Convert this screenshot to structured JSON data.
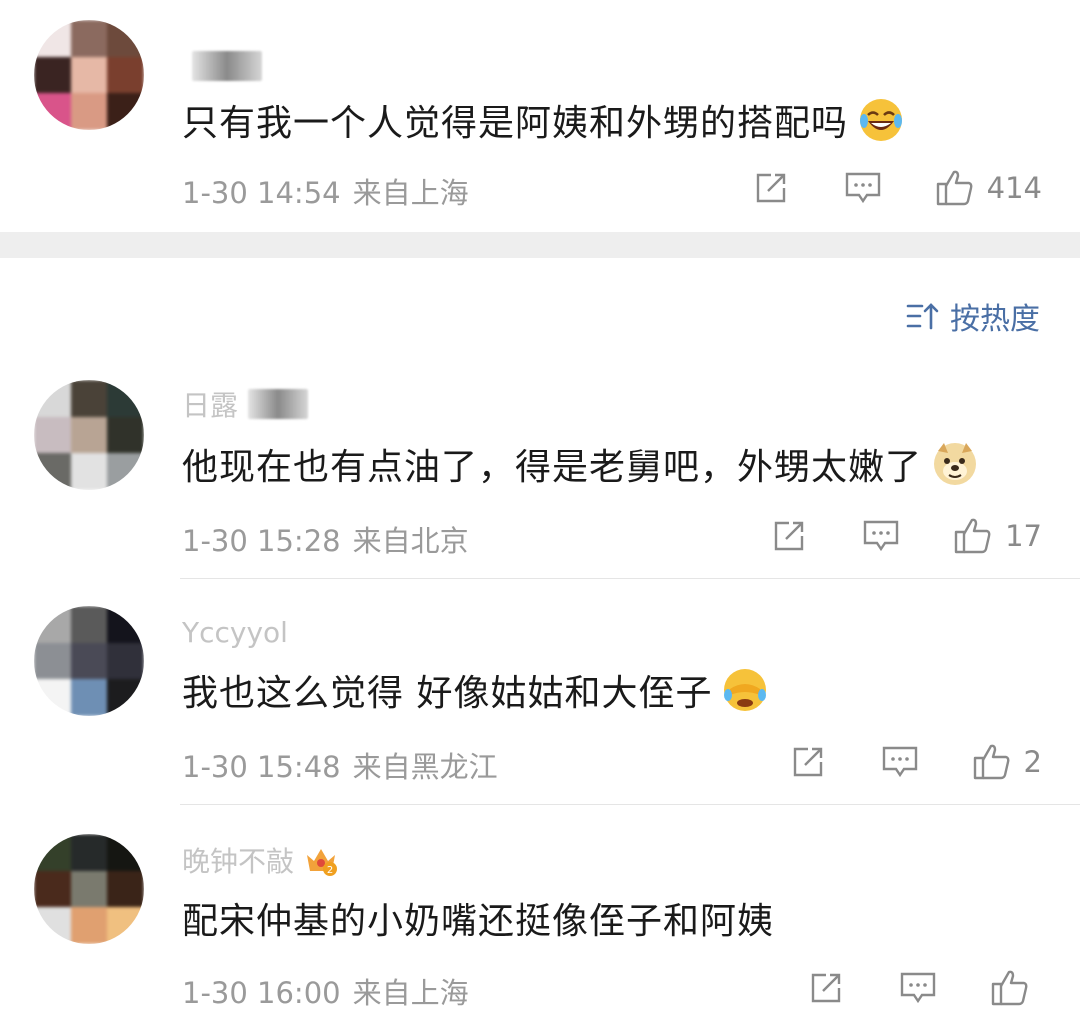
{
  "sort": {
    "label": "按热度",
    "icon": "sort-icon"
  },
  "comments": [
    {
      "username": "",
      "text": "只有我一个人觉得是阿姨和外甥的搭配吗",
      "emoji": "laugh-tears-emoji",
      "date": "1-30 14:54",
      "location": "来自上海",
      "likes": "414",
      "avatar_colors": [
        "#f0e6e6",
        "#8b6a5f",
        "#6d4a3c",
        "#3a2422",
        "#e6b8a6",
        "#7a3f2e",
        "#d9548a",
        "#d99a84",
        "#3b2018"
      ]
    },
    {
      "username": "日露",
      "text": "他现在也有点油了，得是老舅吧，外甥太嫩了",
      "emoji": "doge-emoji",
      "date": "1-30 15:28",
      "location": "来自北京",
      "likes": "17",
      "avatar_colors": [
        "#d8d8d8",
        "#4a4238",
        "#2c3a36",
        "#c8bcc0",
        "#b8a494",
        "#30322a",
        "#6a6a66",
        "#e2e2e2",
        "#9a9ea0"
      ]
    },
    {
      "username": "Yccyyol",
      "text": "我也这么觉得 好像姑姑和大侄子",
      "emoji": "cover-face-emoji",
      "date": "1-30 15:48",
      "location": "来自黑龙江",
      "likes": "2",
      "avatar_colors": [
        "#a8a8a8",
        "#5a5a5a",
        "#14141c",
        "#8c8f94",
        "#4a4a56",
        "#30303a",
        "#f4f4f4",
        "#6e8fb4",
        "#1c1c1e"
      ]
    },
    {
      "username": "晚钟不敲",
      "text": "配宋仲基的小奶嘴还挺像侄子和阿姨",
      "emoji": "",
      "date": "1-30 16:00",
      "location": "来自上海",
      "likes": "",
      "avatar_colors": [
        "#34402a",
        "#262a2a",
        "#151612",
        "#4a2a1c",
        "#7a7a6e",
        "#3a2418",
        "#e0e0e0",
        "#e0a070",
        "#f0c080"
      ]
    }
  ],
  "icons": {
    "repost": "share-icon",
    "comment": "comment-icon",
    "like": "thumbs-up-icon",
    "crown": "crown-badge-icon"
  },
  "colors": {
    "accent": "#4a6fa5",
    "meta": "#9a9a9a",
    "divider": "#eeeeee"
  }
}
